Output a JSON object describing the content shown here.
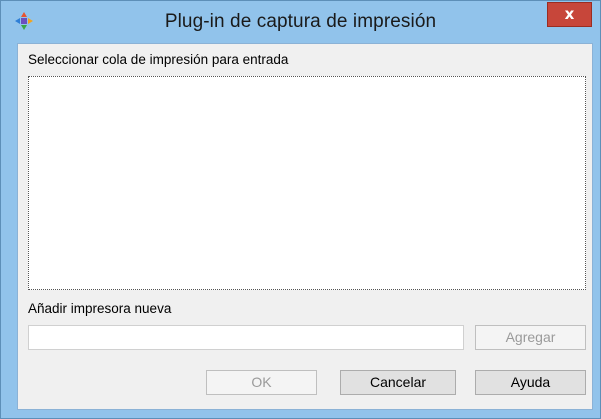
{
  "window": {
    "title": "Plug-in de captura de impresión",
    "app_icon": "colored-cross-icon",
    "close_icon": "x"
  },
  "queue_section": {
    "label": "Seleccionar cola de impresión para entrada",
    "items": []
  },
  "new_printer": {
    "label": "Añadir impresora nueva",
    "input_value": "",
    "add_button": "Agregar",
    "add_enabled": false
  },
  "footer": {
    "ok_button": "OK",
    "ok_enabled": false,
    "cancel_button": "Cancelar",
    "help_button": "Ayuda"
  },
  "colors": {
    "frame": "#91c3eb",
    "close_button": "#c7463a",
    "client_background": "#f0f0f0"
  }
}
